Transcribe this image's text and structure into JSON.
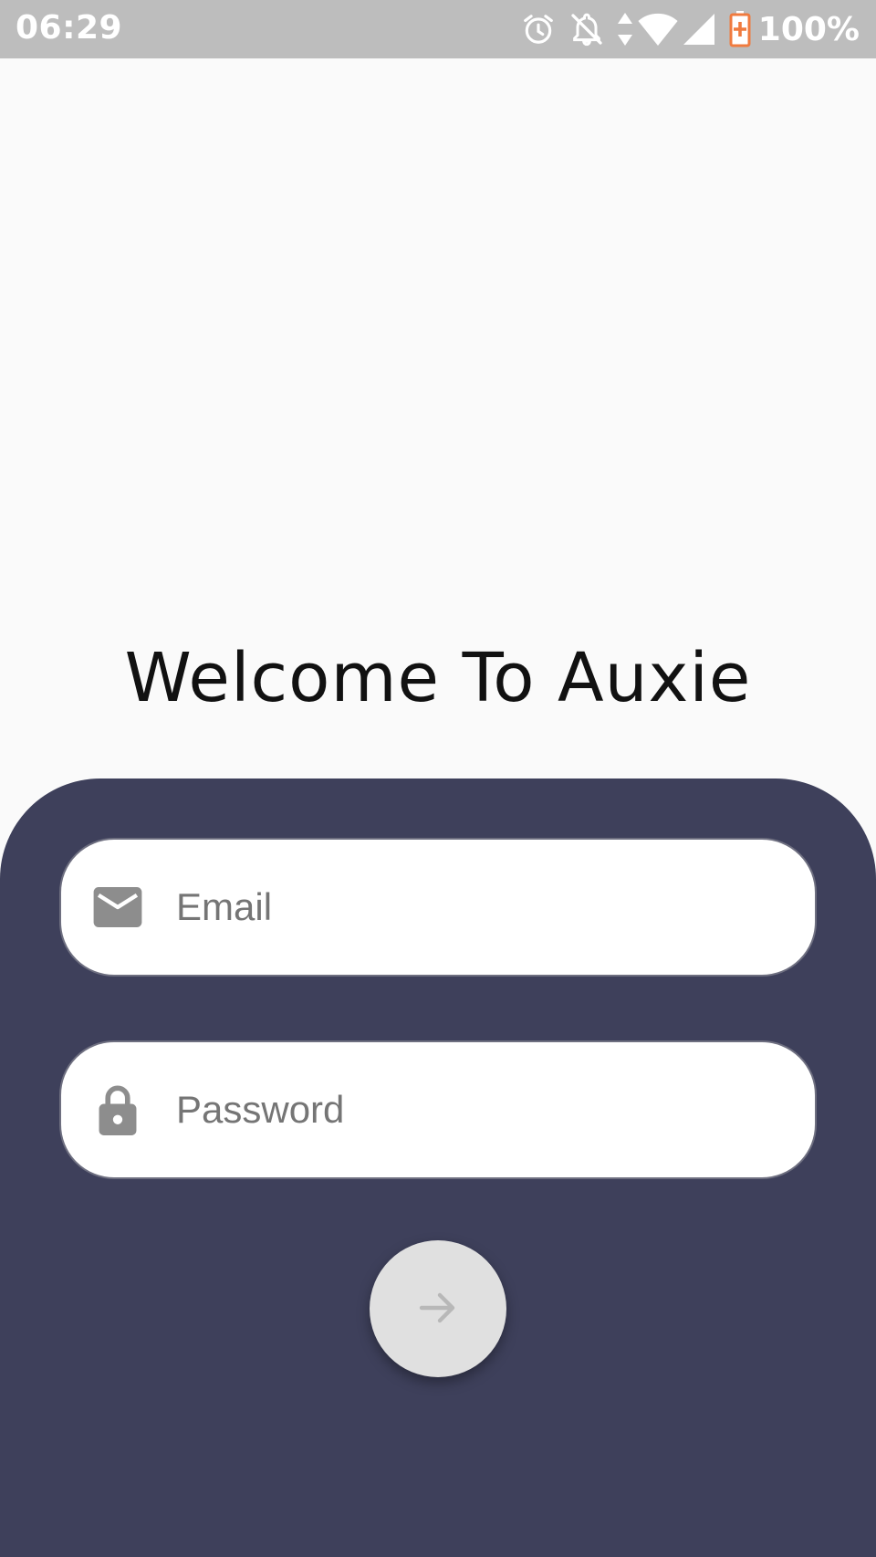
{
  "status_bar": {
    "time": "06:29",
    "battery_percent": "100%",
    "icons": [
      "alarm-icon",
      "notifications-off-icon",
      "data-arrows-icon",
      "wifi-icon",
      "cell-signal-icon",
      "battery-charging-icon"
    ],
    "battery_accent_color": "#f07b3f"
  },
  "welcome": {
    "title": "Welcome To Auxie"
  },
  "login_form": {
    "panel_color": "#3e405b",
    "email": {
      "icon": "email-icon",
      "placeholder": "Email",
      "value": ""
    },
    "password": {
      "icon": "lock-icon",
      "placeholder": "Password",
      "value": ""
    },
    "submit": {
      "icon": "arrow-right-icon",
      "state": "disabled"
    }
  }
}
